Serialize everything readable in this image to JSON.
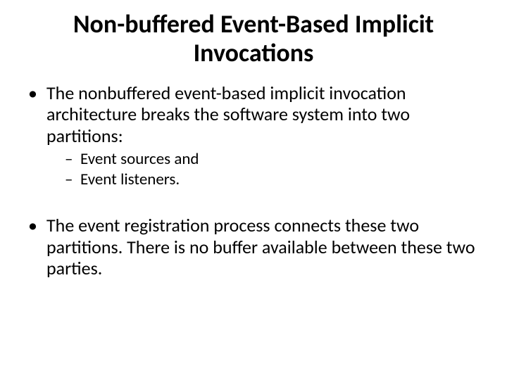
{
  "title": "Non-buffered Event-Based Implicit Invocations",
  "bullets": {
    "b1": "The nonbuffered event-based implicit invocation architecture breaks the software system into two partitions:",
    "b1_sub": {
      "s1": "Event sources and",
      "s2": "Event listeners."
    },
    "b2": "The event registration process connects these two partitions. There is no buffer available between these two parties."
  }
}
